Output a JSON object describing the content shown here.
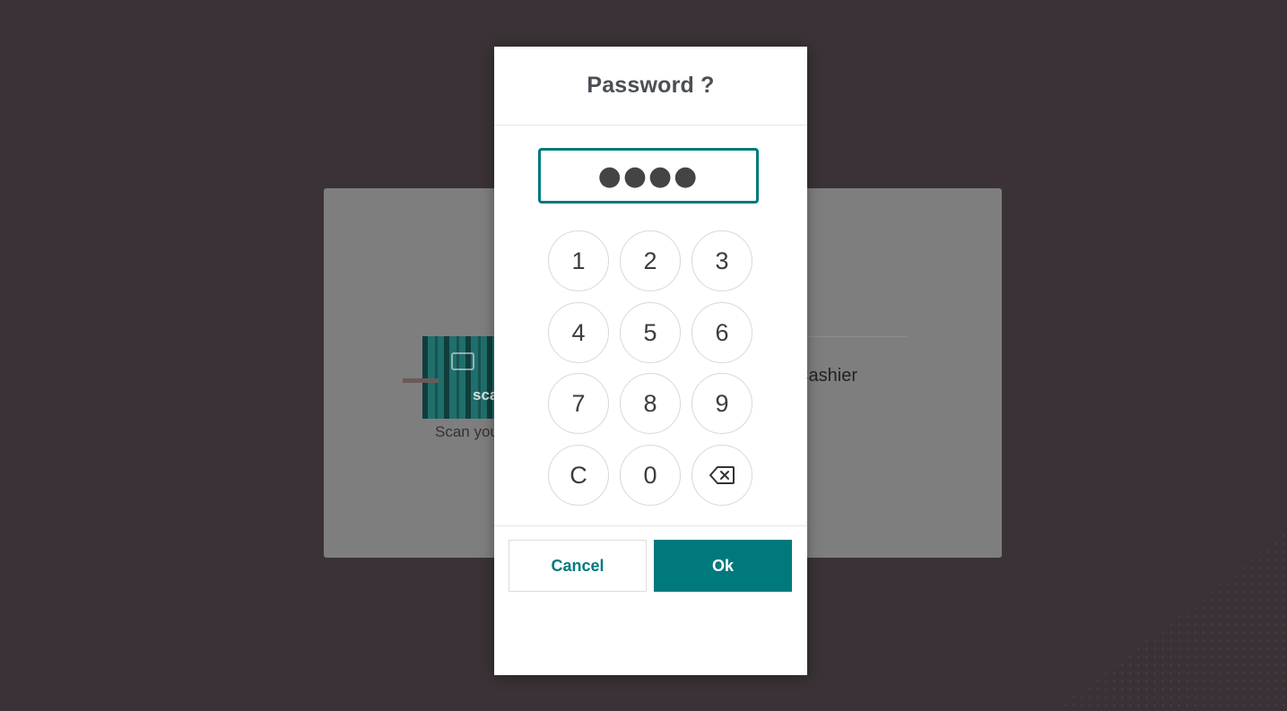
{
  "background": {
    "scan_caption": "Scan you",
    "badge_text": "sca",
    "select_cashier": "ct Cashier"
  },
  "modal": {
    "title": "Password ?",
    "password_value": "●●●●",
    "keypad": {
      "keys": [
        "1",
        "2",
        "3",
        "4",
        "5",
        "6",
        "7",
        "8",
        "9",
        "C",
        "0"
      ],
      "backspace_icon": "backspace-icon"
    },
    "cancel_label": "Cancel",
    "ok_label": "Ok"
  },
  "colors": {
    "accent": "#00797d",
    "backdrop": "#3a3236",
    "dimmed_panel": "#7e7e7e"
  }
}
